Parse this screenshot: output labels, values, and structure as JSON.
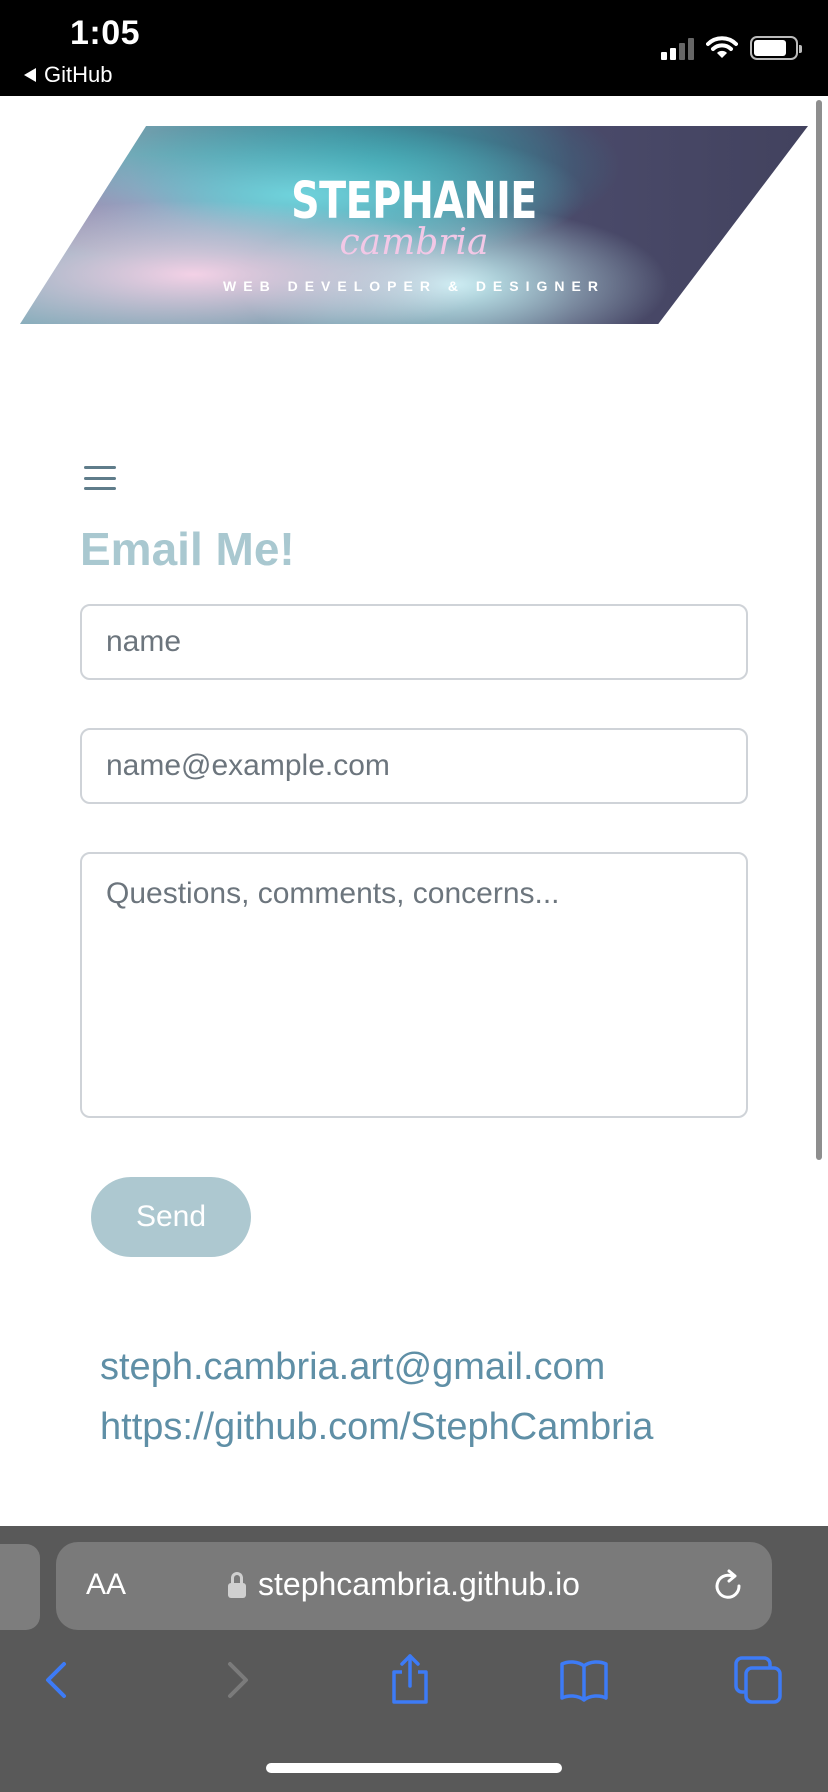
{
  "status_bar": {
    "time": "1:05",
    "back_app": "GitHub",
    "icons": [
      "signal-icon",
      "wifi-icon",
      "battery-icon"
    ]
  },
  "banner": {
    "name": "STEPHANIE",
    "script_name": "cambria",
    "tagline": "WEB DEVELOPER & DESIGNER"
  },
  "menu_icon": "hamburger-menu-icon",
  "form": {
    "title": "Email Me!",
    "name_placeholder": "name",
    "email_placeholder": "name@example.com",
    "message_placeholder": "Questions, comments, concerns...",
    "send_label": "Send"
  },
  "contact": {
    "email": "steph.cambria.art@gmail.com",
    "github": "https://github.com/StephCambria"
  },
  "browser": {
    "aa_label": "AA",
    "url": "stephcambria.github.io",
    "toolbar_icons": [
      "back-icon",
      "forward-icon",
      "share-icon",
      "bookmarks-icon",
      "tabs-icon"
    ]
  },
  "colors": {
    "accent": "#a9c8d0",
    "button": "#adc8d0",
    "link": "#5f8fa6",
    "browser_bar": "#595959",
    "toolbar_icon": "#3d7bf6"
  }
}
